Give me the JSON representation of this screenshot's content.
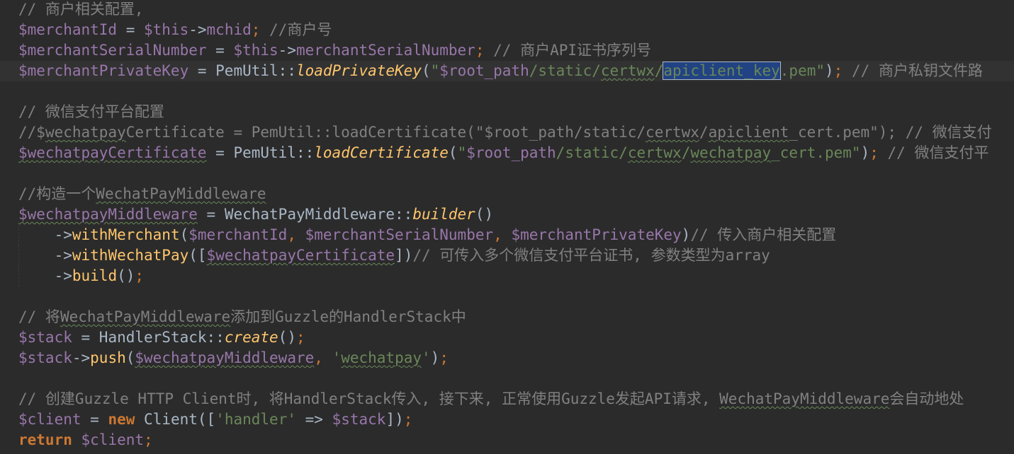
{
  "colors": {
    "background": "#2b2b2b",
    "current_line": "#323232",
    "variable": "#9876aa",
    "comment": "#808080",
    "method": "#ffc66d",
    "string": "#6a8759",
    "keyword": "#cc7832",
    "plain": "#a9b7c6",
    "selection": "#214283"
  },
  "lines": [
    [
      {
        "t": "// 商户相关配置,",
        "c": "comment"
      }
    ],
    [
      {
        "t": "$merchantId",
        "c": "var"
      },
      {
        "t": " = ",
        "c": "plain"
      },
      {
        "t": "$this",
        "c": "var"
      },
      {
        "t": "->",
        "c": "plain"
      },
      {
        "t": "mchid",
        "c": "var"
      },
      {
        "t": ";",
        "c": "punc"
      },
      {
        "t": " //商户号",
        "c": "comment"
      }
    ],
    [
      {
        "t": "$merchantSerialNumber",
        "c": "var"
      },
      {
        "t": " = ",
        "c": "plain"
      },
      {
        "t": "$this",
        "c": "var"
      },
      {
        "t": "->",
        "c": "plain"
      },
      {
        "t": "merchantSerialNumber",
        "c": "var"
      },
      {
        "t": ";",
        "c": "punc"
      },
      {
        "t": " // 商户API证书序列号",
        "c": "comment"
      }
    ],
    [
      {
        "t": "$merchantPrivateKey",
        "c": "var"
      },
      {
        "t": " = ",
        "c": "plain"
      },
      {
        "t": "PemUtil",
        "c": "plain"
      },
      {
        "t": "::",
        "c": "plain"
      },
      {
        "t": "loadPrivateKey",
        "c": "fn-italic"
      },
      {
        "t": "(",
        "c": "plain"
      },
      {
        "t": "\"",
        "c": "str"
      },
      {
        "t": "$root_path",
        "c": "var"
      },
      {
        "t": "/static/",
        "c": "str"
      },
      {
        "t": "certwx",
        "c": "str",
        "typo": true
      },
      {
        "t": "/",
        "c": "str"
      },
      {
        "t": "apiclient_key",
        "c": "sel"
      },
      {
        "t": ".pem\"",
        "c": "str"
      },
      {
        "t": ")",
        "c": "plain"
      },
      {
        "t": ";",
        "c": "punc"
      },
      {
        "t": " // 商户私钥文件路",
        "c": "comment"
      }
    ],
    [],
    [
      {
        "t": "// 微信支付平台配置",
        "c": "comment"
      }
    ],
    [
      {
        "t": "//$",
        "c": "comment"
      },
      {
        "t": "wechatpay",
        "c": "comment",
        "typo": true
      },
      {
        "t": "Certificate = PemUtil::loadCertificate(\"$root_path/static/",
        "c": "comment"
      },
      {
        "t": "certwx",
        "c": "comment",
        "typo": true
      },
      {
        "t": "/",
        "c": "comment"
      },
      {
        "t": "apiclient",
        "c": "comment",
        "typo": true
      },
      {
        "t": "_cert.pem\"); // 微信支付",
        "c": "comment"
      }
    ],
    [
      {
        "t": "$wechatpayCertificate",
        "c": "var",
        "typo": true
      },
      {
        "t": " = ",
        "c": "plain"
      },
      {
        "t": "PemUtil",
        "c": "plain"
      },
      {
        "t": "::",
        "c": "plain"
      },
      {
        "t": "loadCertificate",
        "c": "fn-italic"
      },
      {
        "t": "(",
        "c": "plain"
      },
      {
        "t": "\"",
        "c": "str"
      },
      {
        "t": "$root_path",
        "c": "var"
      },
      {
        "t": "/static/",
        "c": "str"
      },
      {
        "t": "certwx",
        "c": "str",
        "typo": true
      },
      {
        "t": "/",
        "c": "str"
      },
      {
        "t": "wechatpay",
        "c": "str",
        "typo": true
      },
      {
        "t": "_cert.pem\"",
        "c": "str"
      },
      {
        "t": ")",
        "c": "plain"
      },
      {
        "t": ";",
        "c": "punc"
      },
      {
        "t": " // 微信支付平",
        "c": "comment"
      }
    ],
    [],
    [
      {
        "t": "//构造一个",
        "c": "comment"
      },
      {
        "t": "WechatPayMiddleware",
        "c": "comment",
        "typo": true
      }
    ],
    [
      {
        "t": "$wechatpayMiddleware",
        "c": "var",
        "typo": true
      },
      {
        "t": " = ",
        "c": "plain"
      },
      {
        "t": "WechatPayMiddleware",
        "c": "plain"
      },
      {
        "t": "::",
        "c": "plain"
      },
      {
        "t": "builder",
        "c": "fn-italic"
      },
      {
        "t": "()",
        "c": "plain"
      }
    ],
    [
      {
        "t": "    ",
        "c": "plain",
        "indent": true
      },
      {
        "t": "->",
        "c": "plain"
      },
      {
        "t": "withMerchant",
        "c": "method"
      },
      {
        "t": "(",
        "c": "plain"
      },
      {
        "t": "$merchantId",
        "c": "var"
      },
      {
        "t": ", ",
        "c": "punc"
      },
      {
        "t": "$merchantSerialNumber",
        "c": "var"
      },
      {
        "t": ", ",
        "c": "punc"
      },
      {
        "t": "$merchantPrivateKey",
        "c": "var"
      },
      {
        "t": ")",
        "c": "plain"
      },
      {
        "t": "// 传入商户相关配置",
        "c": "comment"
      }
    ],
    [
      {
        "t": "    ",
        "c": "plain",
        "indent": true
      },
      {
        "t": "->",
        "c": "plain"
      },
      {
        "t": "withWechatPay",
        "c": "method"
      },
      {
        "t": "([",
        "c": "plain"
      },
      {
        "t": "$wechatpayCertificate",
        "c": "var",
        "typo": true
      },
      {
        "t": "])",
        "c": "plain"
      },
      {
        "t": "// 可传入多个微信支付平台证书, 参数类型为array",
        "c": "comment"
      }
    ],
    [
      {
        "t": "    ",
        "c": "plain",
        "indent": true
      },
      {
        "t": "->",
        "c": "plain"
      },
      {
        "t": "build",
        "c": "method"
      },
      {
        "t": "()",
        "c": "plain"
      },
      {
        "t": ";",
        "c": "punc"
      }
    ],
    [],
    [
      {
        "t": "// 将",
        "c": "comment"
      },
      {
        "t": "WechatPayMiddleware",
        "c": "comment",
        "typo": true
      },
      {
        "t": "添加到Guzzle的HandlerStack中",
        "c": "comment"
      }
    ],
    [
      {
        "t": "$stack",
        "c": "var"
      },
      {
        "t": " = ",
        "c": "plain"
      },
      {
        "t": "HandlerStack",
        "c": "plain"
      },
      {
        "t": "::",
        "c": "plain"
      },
      {
        "t": "create",
        "c": "fn-italic"
      },
      {
        "t": "()",
        "c": "plain"
      },
      {
        "t": ";",
        "c": "punc"
      }
    ],
    [
      {
        "t": "$stack",
        "c": "var"
      },
      {
        "t": "->",
        "c": "plain"
      },
      {
        "t": "push",
        "c": "method"
      },
      {
        "t": "(",
        "c": "plain"
      },
      {
        "t": "$wechatpayMiddleware",
        "c": "var",
        "typo": true
      },
      {
        "t": ", ",
        "c": "punc"
      },
      {
        "t": "'",
        "c": "str"
      },
      {
        "t": "wechatpay",
        "c": "str",
        "typo": true
      },
      {
        "t": "'",
        "c": "str"
      },
      {
        "t": ")",
        "c": "plain"
      },
      {
        "t": ";",
        "c": "punc"
      }
    ],
    [],
    [
      {
        "t": "// 创建Guzzle HTTP Client时, 将HandlerStack传入, 接下来, 正常使用Guzzle发起API请求, ",
        "c": "comment"
      },
      {
        "t": "WechatPayMiddleware",
        "c": "comment",
        "typo": true
      },
      {
        "t": "会自动地处",
        "c": "comment"
      }
    ],
    [
      {
        "t": "$client",
        "c": "var"
      },
      {
        "t": " = ",
        "c": "plain"
      },
      {
        "t": "new",
        "c": "kw-bold"
      },
      {
        "t": " ",
        "c": "plain"
      },
      {
        "t": "Client",
        "c": "plain"
      },
      {
        "t": "([",
        "c": "plain"
      },
      {
        "t": "'handler'",
        "c": "str"
      },
      {
        "t": " => ",
        "c": "plain"
      },
      {
        "t": "$stack",
        "c": "var"
      },
      {
        "t": "])",
        "c": "plain"
      },
      {
        "t": ";",
        "c": "punc"
      }
    ],
    [
      {
        "t": "return",
        "c": "kw-bold"
      },
      {
        "t": " ",
        "c": "plain"
      },
      {
        "t": "$client",
        "c": "var"
      },
      {
        "t": ";",
        "c": "punc"
      }
    ]
  ],
  "current_line_index": 3
}
